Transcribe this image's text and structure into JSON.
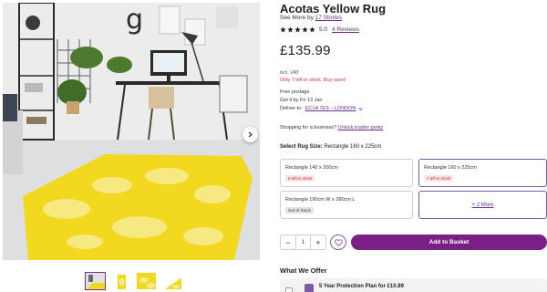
{
  "product": {
    "title": "Acotas Yellow Rug",
    "see_more_prefix": "See More by",
    "brand_link": "17 Stories",
    "rating": "5.0",
    "reviews": "4 Reviews",
    "price": "£135.99",
    "vat": "incl. VAT",
    "stock_warning": "Only 7 left in stock. Buy soon!"
  },
  "delivery": {
    "postage": "Free postage",
    "get_it_by": "Get it by Fri 13 Jan",
    "deliver_to_label": "Deliver to:",
    "postcode": "EC1A 7ES – LONDON"
  },
  "business": {
    "prompt": "Shopping for a business?",
    "link": "Unlock insider perks"
  },
  "size": {
    "label": "Select Rug Size:",
    "selected": "Rectangle 160 x 225cm",
    "options": [
      {
        "name": "Rectangle 140 x 200cm",
        "badge": "5 left in stock"
      },
      {
        "name": "Rectangle 160 x 225cm",
        "badge": "7 left in stock"
      },
      {
        "name": "Rectangle 190cm W x 280cm L",
        "badge": "Out of Stock"
      }
    ],
    "more": "+ 2 More"
  },
  "purchase": {
    "minus": "−",
    "quantity": "1",
    "plus": "+",
    "add_to_basket": "Add to Basket"
  },
  "offer": {
    "title": "What We Offer",
    "protection": "5 Year Protection Plan for £10.89"
  },
  "icons": {
    "star": "star-icon",
    "heart": "heart-icon",
    "next": "chevron-right-icon",
    "dropdown": "chevron-down-icon"
  },
  "colors": {
    "brand_purple": "#7a1f86",
    "link_purple": "#6b2d85",
    "stock_red": "#d12c2c",
    "rug_yellow": "#f2d81e",
    "star": "#1d1d1f"
  }
}
